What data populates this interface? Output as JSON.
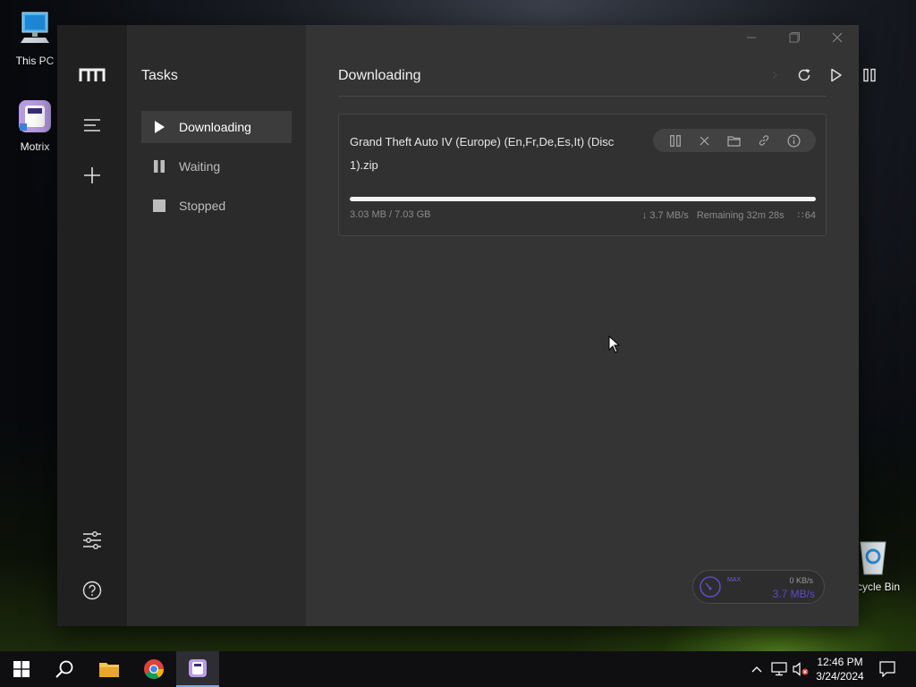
{
  "desktop": {
    "icons": [
      {
        "label": "This PC"
      },
      {
        "label": "Motrix"
      },
      {
        "label": "cycle Bin"
      }
    ]
  },
  "app": {
    "sidebar": {
      "logo": "m",
      "items": [
        "menu-icon",
        "add-icon",
        "preferences-icon",
        "help-icon"
      ]
    },
    "subnav": {
      "title": "Tasks",
      "items": [
        {
          "label": "Downloading",
          "icon": "play-icon",
          "active": true
        },
        {
          "label": "Waiting",
          "icon": "pause-icon",
          "active": false
        },
        {
          "label": "Stopped",
          "icon": "stop-icon",
          "active": false
        }
      ]
    },
    "main": {
      "title": "Downloading",
      "header_actions": [
        "refresh-icon",
        "resume-all-icon",
        "pause-all-icon"
      ],
      "task": {
        "name": "Grand Theft Auto IV (Europe) (En,Fr,De,Es,It) (Disc 1).zip",
        "completed": "3.03 MB / 7.03 GB",
        "speed": "↓ 3.7 MB/s",
        "remaining": "Remaining 32m 28s",
        "connections": "64",
        "progress_percent": 100
      }
    },
    "speedometer": {
      "max_label": "MAX",
      "upload": "0 KB/s",
      "download": "3.7 MB/s"
    }
  },
  "taskbar": {
    "time": "12:46 PM",
    "date": "3/24/2024"
  },
  "colors": {
    "accent": "#5b4bc4",
    "window_bg": "#343434",
    "sidebar_bg": "#202020"
  }
}
